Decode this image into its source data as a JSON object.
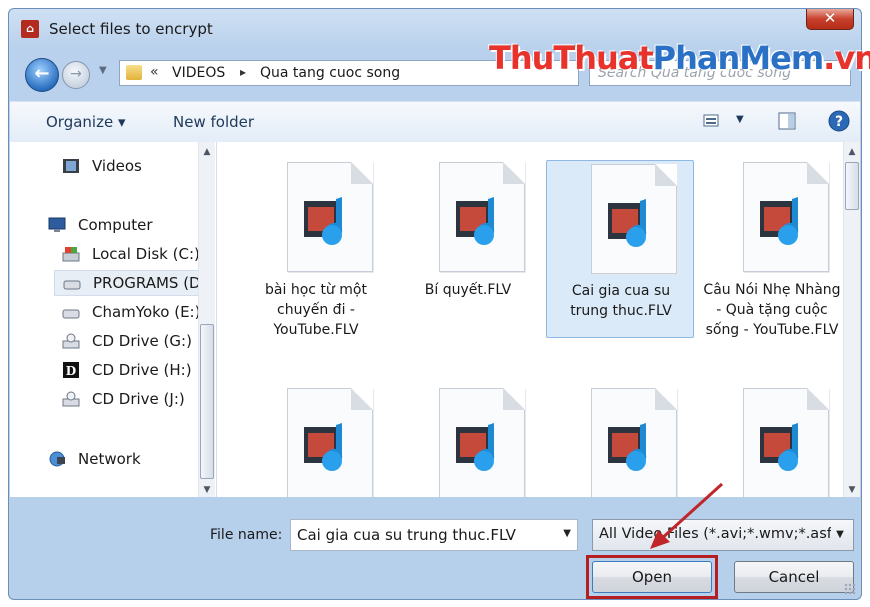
{
  "window": {
    "title": "Select files to encrypt",
    "close_label": "✕"
  },
  "address": {
    "overflow": "«",
    "crumbs": [
      "VIDEOS",
      "Qua tang cuoc song"
    ],
    "separator": "▸"
  },
  "search": {
    "placeholder": "Search Qua tang cuoc song"
  },
  "watermark": {
    "part1": "ThuThuat",
    "part2": "PhanMem",
    "part3": ".vn"
  },
  "toolbar": {
    "organize_label": "Organize ▾",
    "new_folder_label": "New folder"
  },
  "nav": {
    "items": [
      {
        "label": "Videos",
        "icon": "video-library-icon"
      },
      {
        "label": "Computer",
        "icon": "computer-icon"
      },
      {
        "label": "Local Disk (C:)",
        "icon": "local-disk-icon"
      },
      {
        "label": "PROGRAMS (D:)",
        "icon": "drive-icon"
      },
      {
        "label": "ChamYoko (E:)",
        "icon": "drive-icon"
      },
      {
        "label": "CD Drive (G:)",
        "icon": "cd-drive-icon"
      },
      {
        "label": "CD Drive (H:)",
        "icon": "daemon-drive-icon"
      },
      {
        "label": "CD Drive (J:)",
        "icon": "cd-drive-icon"
      },
      {
        "label": "Network",
        "icon": "network-icon"
      }
    ]
  },
  "files": [
    {
      "name": "bài học từ một chuyến đi - YouTube.FLV",
      "selected": false
    },
    {
      "name": "Bí quyết.FLV",
      "selected": false
    },
    {
      "name": "Cai gia cua su trung thuc.FLV",
      "selected": true
    },
    {
      "name": "Câu Nói Nhẹ Nhàng - Quà tặng cuộc sống - YouTube.FLV",
      "selected": false
    },
    {
      "name": "",
      "selected": false
    },
    {
      "name": "",
      "selected": false
    },
    {
      "name": "",
      "selected": false
    },
    {
      "name": "",
      "selected": false
    }
  ],
  "footer": {
    "file_name_label": "File name:",
    "file_name_value": "Cai gia cua su trung thuc.FLV",
    "file_type_value": "All Video Files (*.avi;*.wmv;*.asf",
    "open_label": "Open",
    "cancel_label": "Cancel"
  },
  "colors": {
    "highlight_box": "#b61f22",
    "arrow": "#c0252a",
    "selection": "#dbeaf9"
  }
}
